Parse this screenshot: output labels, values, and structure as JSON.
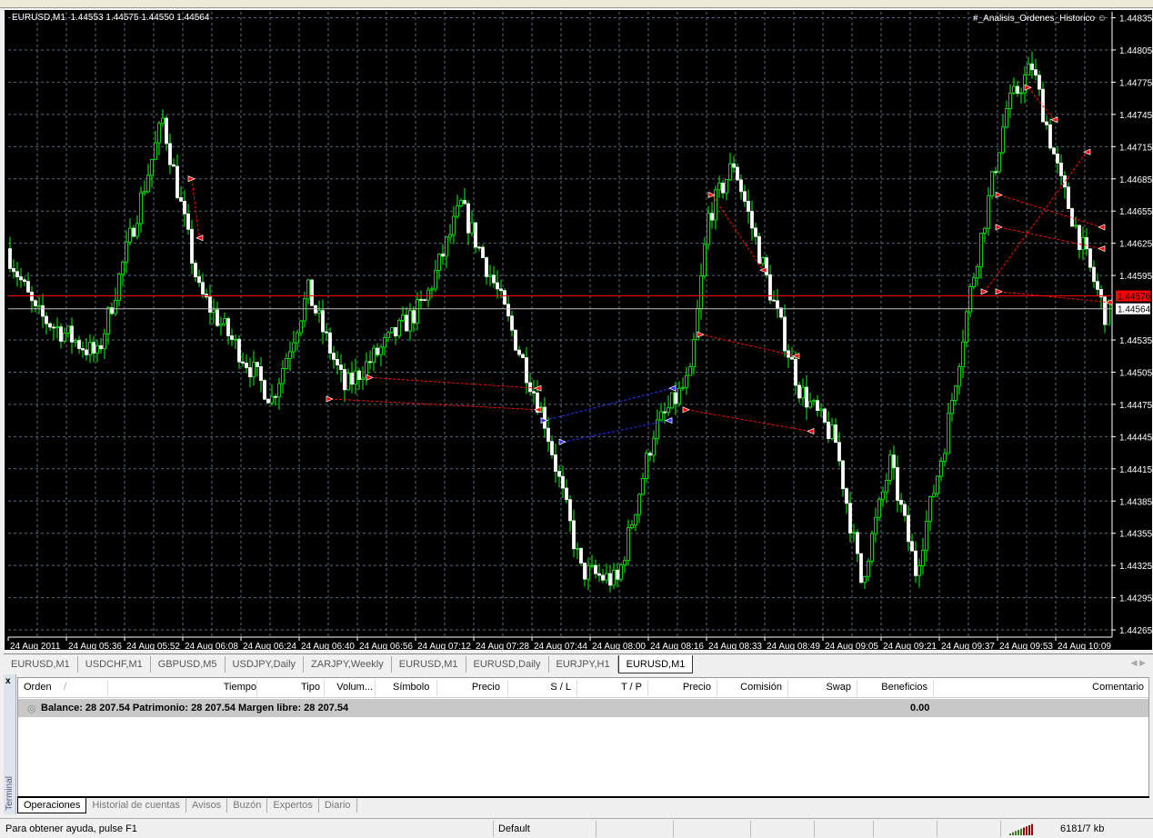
{
  "chart_header": {
    "symbol": "EURUSD,M1",
    "ohlc": "1.44553 1.44575 1.44550 1.44564",
    "expert": "#_Analisis_Ordenes_Historico ☺"
  },
  "chart_data": {
    "type": "candlestick",
    "price_ticks": [
      "1.44835",
      "1.44805",
      "1.44775",
      "1.44745",
      "1.44715",
      "1.44685",
      "1.44655",
      "1.44625",
      "1.44595",
      "1.44535",
      "1.44505",
      "1.44475",
      "1.44445",
      "1.44415",
      "1.44385",
      "1.44355",
      "1.44325",
      "1.44295",
      "1.44265"
    ],
    "ylim": [
      1.44259,
      1.44841
    ],
    "time_labels": [
      "24 Aug 2011",
      "24 Aug 05:36",
      "24 Aug 05:52",
      "24 Aug 06:08",
      "24 Aug 06:24",
      "24 Aug 06:40",
      "24 Aug 06:56",
      "24 Aug 07:12",
      "24 Aug 07:28",
      "24 Aug 07:44",
      "24 Aug 08:00",
      "24 Aug 08:16",
      "24 Aug 08:33",
      "24 Aug 08:49",
      "24 Aug 09:05",
      "24 Aug 09:21",
      "24 Aug 09:37",
      "24 Aug 09:53",
      "24 Aug 10:09"
    ],
    "bars": 303,
    "price_path": [
      [
        0,
        1.4462
      ],
      [
        8,
        1.4456
      ],
      [
        25,
        1.4452
      ],
      [
        43,
        1.4474
      ],
      [
        53,
        1.4458
      ],
      [
        73,
        1.4448
      ],
      [
        83,
        1.4458
      ],
      [
        93,
        1.4449
      ],
      [
        115,
        1.4457
      ],
      [
        125,
        1.4466
      ],
      [
        135,
        1.4458
      ],
      [
        148,
        1.4446
      ],
      [
        158,
        1.4432
      ],
      [
        168,
        1.4431
      ],
      [
        178,
        1.4445
      ],
      [
        188,
        1.445
      ],
      [
        193,
        1.4465
      ],
      [
        200,
        1.447
      ],
      [
        210,
        1.4458
      ],
      [
        218,
        1.4449
      ],
      [
        228,
        1.4444
      ],
      [
        235,
        1.4431
      ],
      [
        243,
        1.4442
      ],
      [
        250,
        1.4432
      ],
      [
        258,
        1.4444
      ],
      [
        265,
        1.4458
      ],
      [
        275,
        1.4475
      ],
      [
        282,
        1.4479
      ],
      [
        290,
        1.4468
      ],
      [
        302,
        1.4456
      ]
    ],
    "trades": [
      {
        "from": [
          50,
          1.44685
        ],
        "to": [
          52,
          1.4463
        ],
        "color": "#ff0000"
      },
      {
        "from": [
          88,
          1.4448
        ],
        "to": [
          145,
          1.4447
        ],
        "color": "#ff0000"
      },
      {
        "from": [
          99,
          1.445
        ],
        "to": [
          145,
          1.4449
        ],
        "color": "#ff0000"
      },
      {
        "from": [
          147,
          1.4446
        ],
        "to": [
          182,
          1.4449
        ],
        "color": "#3030ff"
      },
      {
        "from": [
          152,
          1.4444
        ],
        "to": [
          181,
          1.4446
        ],
        "color": "#3030ff"
      },
      {
        "from": [
          190,
          1.4454
        ],
        "to": [
          216,
          1.4452
        ],
        "color": "#ff0000"
      },
      {
        "from": [
          186,
          1.4447
        ],
        "to": [
          220,
          1.4445
        ],
        "color": "#ff0000"
      },
      {
        "from": [
          193,
          1.4467
        ],
        "to": [
          207,
          1.446
        ],
        "color": "#ff0000"
      },
      {
        "from": [
          272,
          1.4464
        ],
        "to": [
          300,
          1.4462
        ],
        "color": "#ff0000"
      },
      {
        "from": [
          272,
          1.4467
        ],
        "to": [
          300,
          1.4464
        ],
        "color": "#ff0000"
      },
      {
        "from": [
          272,
          1.4458
        ],
        "to": [
          302,
          1.4457
        ],
        "color": "#ff0000"
      },
      {
        "from": [
          268,
          1.4458
        ],
        "to": [
          296,
          1.4471
        ],
        "color": "#ff0000"
      },
      {
        "from": [
          280,
          1.4477
        ],
        "to": [
          287,
          1.4474
        ],
        "color": "#ff0000"
      }
    ],
    "ask_line": 1.44576,
    "ask_label": "1.44576",
    "bid_line": 1.44564,
    "bid_label": "1.44564",
    "colors": {
      "up": "#00ff00",
      "down": "#ffffff",
      "grid": "#5a6a7a",
      "ask": "#ff0000",
      "bid": "#c0c0c0"
    }
  },
  "chart_tabs": [
    "EURUSD,M1",
    "USDCHF,M1",
    "GBPUSD,M5",
    "USDJPY,Daily",
    "ZARJPY,Weekly",
    "EURUSD,M1",
    "EURUSD,Daily",
    "EURJPY,H1",
    "EURUSD,M1"
  ],
  "terminal": {
    "close": "x",
    "label": "Terminal",
    "columns": [
      "Orden",
      "Tiempo",
      "Tipo",
      "Volum...",
      "Símbolo",
      "Precio",
      "S / L",
      "T / P",
      "Precio",
      "Comisión",
      "Swap",
      "Beneficios",
      "Comentario"
    ],
    "sort_indicator": "/",
    "balance_text": "Balance: 28 207.54  Patrimonio: 28 207.54  Margen libre: 28 207.54",
    "profit": "0.00",
    "tabs": [
      "Operaciones",
      "Historial de cuentas",
      "Avisos",
      "Buzón",
      "Expertos",
      "Diario"
    ]
  },
  "status": {
    "help": "Para obtener ayuda, pulse F1",
    "profile": "Default",
    "traffic": "6181/7 kb"
  }
}
